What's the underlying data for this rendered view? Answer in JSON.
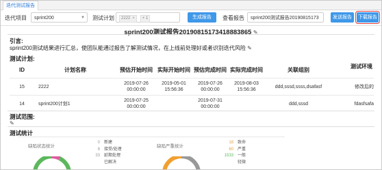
{
  "tab": {
    "label": "迭代测试报告"
  },
  "toolbar": {
    "iteration_label": "迭代项目",
    "iteration_value": "sprint200",
    "plan_label": "测试计划",
    "plan_tag": "2222",
    "plan_more": "+ 1",
    "generate_btn": "生成报告",
    "view_label": "查看报告",
    "report_value": "sprint200测试报告20190815173",
    "send_btn": "发送报告",
    "download_btn": "下载报告"
  },
  "report": {
    "title": "sprint200测试报告20190815173418883865",
    "intro_heading": "引言:",
    "intro_text": "sprint200测试结果进行汇总，使团队能通过报告了解测试情况，在上线前处理好或者识别迭代风险",
    "plan_heading": "测试计划:",
    "scope_heading": "测试范围:",
    "stats_heading": "测试统计"
  },
  "plan_table": {
    "headers": [
      "ID",
      "计划名称",
      "预估开始时间",
      "实际开始时间",
      "预估完成时间",
      "实际完成时间",
      "关联组别",
      "测试环境"
    ],
    "rows": [
      {
        "id": "15",
        "name": "2222",
        "est_start": "2019-07-26 00:00:00",
        "act_start": "2019-05-01 15:56:36",
        "est_end": "2019-07-26 00:00:00",
        "act_end": "2019-08-03 15:56:36",
        "groups": "ddd,sssd,ssss,dsafasf",
        "env": "修改后的"
      },
      {
        "id": "14",
        "name": "sprint200计划1",
        "est_start": "2019-07-25 00:00:00",
        "act_start": "",
        "est_end": "2019-07-31 00:00:00",
        "act_end": "",
        "groups": "ddd,sssd",
        "env": "fdasfsafa"
      }
    ]
  },
  "stats": {
    "defect_status_label": "缺陷状态统计",
    "defect_status_legend": [
      {
        "count": "0",
        "label": "新建"
      },
      {
        "count": "8",
        "label": "接受/处理"
      },
      {
        "count": "33",
        "label": "延期处理"
      },
      {
        "count": "",
        "label": "已解决"
      }
    ],
    "defect_severity_label": "缺陷严重统计",
    "defect_severity_legend": [
      {
        "count": "18",
        "label": "致命"
      },
      {
        "count": "60",
        "label": "严重"
      },
      {
        "count": "1533",
        "label": "一般"
      },
      {
        "count": "",
        "label": "轻微"
      }
    ]
  },
  "colors": {
    "accent": "#3f98e8",
    "highlight": "#e23b3b",
    "donut1": "#5cb85c",
    "donut2": "#e05aa0",
    "donut3": "#f0a030"
  }
}
